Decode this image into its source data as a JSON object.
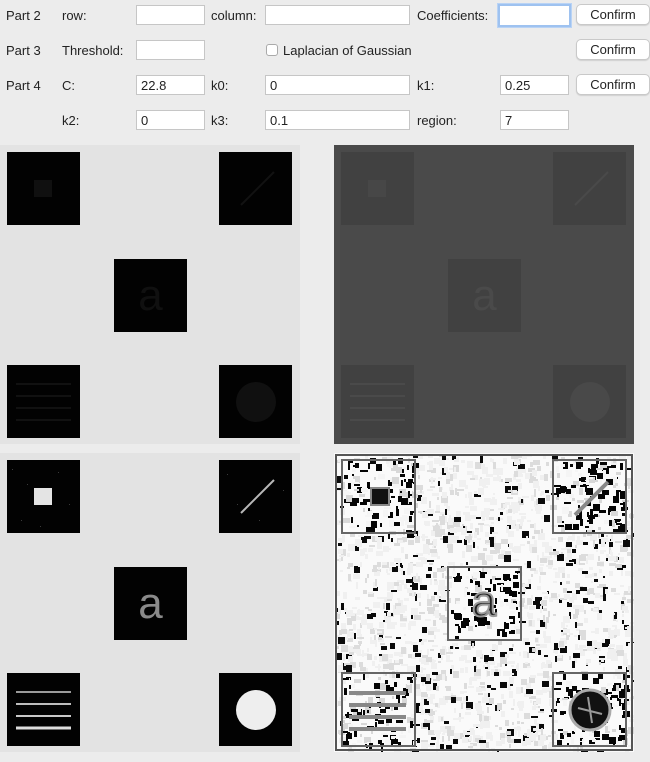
{
  "part2": {
    "part_label": "Part 2",
    "row_label": "row:",
    "row_value": "",
    "column_label": "column:",
    "column_value": "",
    "coefficients_label": "Coefficients:",
    "coefficients_value": "",
    "confirm_label": "Confirm"
  },
  "part3": {
    "part_label": "Part 3",
    "threshold_label": "Threshold:",
    "threshold_value": "",
    "log_label": "Laplacian of Gaussian",
    "log_checked": false,
    "confirm_label": "Confirm"
  },
  "part4": {
    "part_label": "Part 4",
    "c_label": "C:",
    "c_value": "22.8",
    "k0_label": "k0:",
    "k0_value": "0",
    "k1_label": "k1:",
    "k1_value": "0.25",
    "confirm_label": "Confirm",
    "k2_label": "k2:",
    "k2_value": "0",
    "k3_label": "k3:",
    "k3_value": "0.1",
    "region_label": "region:",
    "region_value": "7"
  },
  "images": {
    "tile_letter": "a"
  }
}
